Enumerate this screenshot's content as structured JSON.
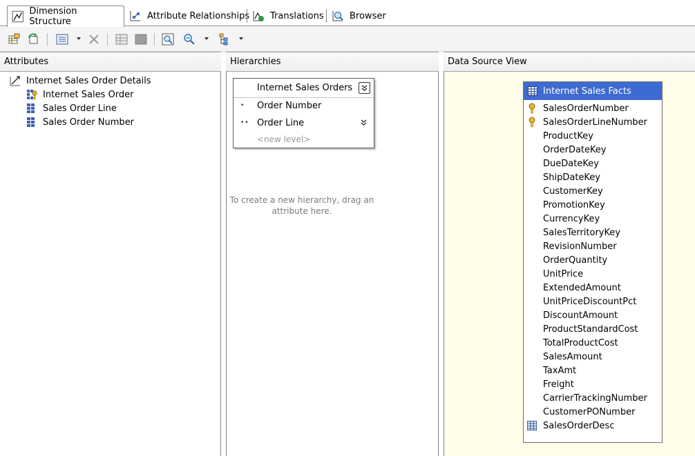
{
  "tabs": [
    {
      "label": "Dimension Structure",
      "icon": "dimension-structure-icon",
      "active": true
    },
    {
      "label": "Attribute Relationships",
      "icon": "attribute-relationships-icon",
      "active": false
    },
    {
      "label": "Translations",
      "icon": "translations-icon",
      "active": false
    },
    {
      "label": "Browser",
      "icon": "browser-icon",
      "active": false
    }
  ],
  "toolbar": {
    "icons": [
      "add-table-icon",
      "refresh-icon",
      "view-icon",
      "delete-icon",
      "show-grid-icon",
      "stop-icon",
      "zoom-fit-icon",
      "zoom-icon",
      "arrange-icon"
    ]
  },
  "panes": {
    "attributes": "Attributes",
    "hierarchies": "Hierarchies",
    "dsv": "Data Source View"
  },
  "attributes": {
    "root": "Internet Sales Order Details",
    "items": [
      "Internet Sales Order",
      "Sales Order Line",
      "Sales Order Number"
    ]
  },
  "hierarchy": {
    "title": "Internet Sales Orders",
    "levels": [
      {
        "dots": "•",
        "label": "Order Number"
      },
      {
        "dots": "••",
        "label": "Order Line"
      }
    ],
    "new_level": "<new level>",
    "hint": "To create a new hierarchy, drag an attribute here."
  },
  "table": {
    "name": "Internet Sales Facts",
    "columns": [
      {
        "name": "SalesOrderNumber",
        "icon": "key"
      },
      {
        "name": "SalesOrderLineNumber",
        "icon": "key"
      },
      {
        "name": "ProductKey",
        "icon": ""
      },
      {
        "name": "OrderDateKey",
        "icon": ""
      },
      {
        "name": "DueDateKey",
        "icon": ""
      },
      {
        "name": "ShipDateKey",
        "icon": ""
      },
      {
        "name": "CustomerKey",
        "icon": ""
      },
      {
        "name": "PromotionKey",
        "icon": ""
      },
      {
        "name": "CurrencyKey",
        "icon": ""
      },
      {
        "name": "SalesTerritoryKey",
        "icon": ""
      },
      {
        "name": "RevisionNumber",
        "icon": ""
      },
      {
        "name": "OrderQuantity",
        "icon": ""
      },
      {
        "name": "UnitPrice",
        "icon": ""
      },
      {
        "name": "ExtendedAmount",
        "icon": ""
      },
      {
        "name": "UnitPriceDiscountPct",
        "icon": ""
      },
      {
        "name": "DiscountAmount",
        "icon": ""
      },
      {
        "name": "ProductStandardCost",
        "icon": ""
      },
      {
        "name": "TotalProductCost",
        "icon": ""
      },
      {
        "name": "SalesAmount",
        "icon": ""
      },
      {
        "name": "TaxAmt",
        "icon": ""
      },
      {
        "name": "Freight",
        "icon": ""
      },
      {
        "name": "CarrierTrackingNumber",
        "icon": ""
      },
      {
        "name": "CustomerPONumber",
        "icon": ""
      },
      {
        "name": "SalesOrderDesc",
        "icon": "calc"
      }
    ]
  },
  "colors": {
    "table_header": "#3e6bd1",
    "dsv_background": "#fdfde9"
  }
}
